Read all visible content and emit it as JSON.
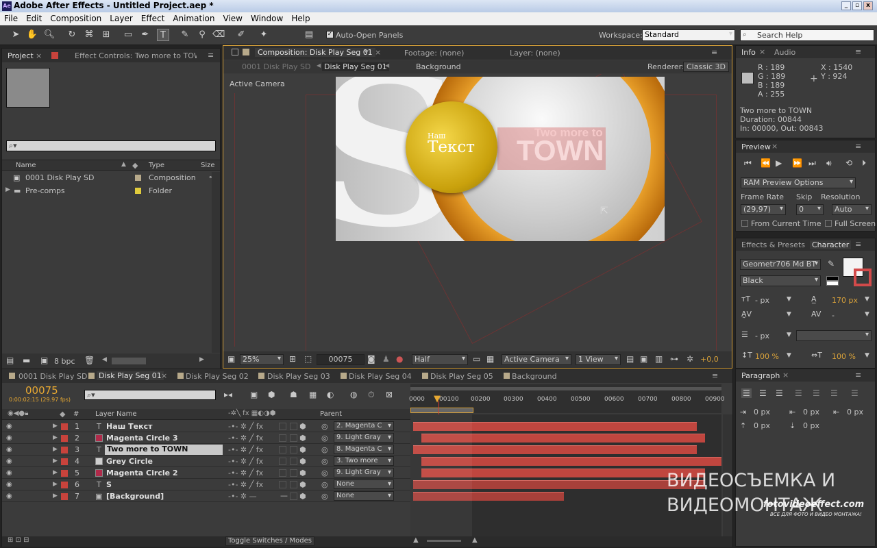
{
  "window": {
    "title": "Adobe After Effects - Untitled Project.aep *",
    "app_icon": "Ae"
  },
  "menu": [
    "File",
    "Edit",
    "Composition",
    "Layer",
    "Effect",
    "Animation",
    "View",
    "Window",
    "Help"
  ],
  "toolbar": {
    "auto_open_label": "Auto-Open Panels",
    "workspace_label": "Workspace:",
    "workspace_value": "Standard",
    "search_placeholder": "Search Help"
  },
  "project_panel": {
    "tab_project": "Project",
    "tab_effect_controls": "Effect Controls: Two more to TOWN",
    "columns": {
      "name": "Name",
      "type": "Type",
      "size": "Size"
    },
    "items": [
      {
        "name": "0001 Disk Play SD",
        "type": "Composition"
      },
      {
        "name": "Pre-comps",
        "type": "Folder"
      }
    ],
    "bpc": "8 bpc"
  },
  "comp_panel": {
    "tab_comp": "Composition: Disk Play Seg 01",
    "tab_footage": "Footage: (none)",
    "tab_layer": "Layer: (none)",
    "breadcrumbs": [
      "0001 Disk Play SD",
      "Disk Play Seg 01",
      "Background"
    ],
    "renderer_label": "Renderer:",
    "renderer_value": "Classic 3D",
    "active_camera": "Active Camera",
    "art_small": "Наш",
    "art_big": "Текст",
    "art_two": "Two more to",
    "art_town": "TOWN",
    "zoom": "25%",
    "timecode": "00075",
    "resolution": "Half",
    "camera": "Active Camera",
    "view": "1 View",
    "offset": "+0,0"
  },
  "info_panel": {
    "tab_info": "Info",
    "tab_audio": "Audio",
    "r": "R : 189",
    "g": "G : 189",
    "b": "B : 189",
    "a": "A : 255",
    "x": "X : 1540",
    "y": "Y : 924",
    "layer_name": "Two more to TOWN",
    "duration": "Duration: 00844",
    "in_out": "In: 00000, Out: 00843"
  },
  "preview_panel": {
    "tab": "Preview",
    "ram_options": "RAM Preview Options",
    "frame_rate_label": "Frame Rate",
    "skip_label": "Skip",
    "resolution_label": "Resolution",
    "frame_rate": "(29,97)",
    "skip": "0",
    "resolution": "Auto",
    "from_current": "From Current Time",
    "full_screen": "Full Screen"
  },
  "character_panel": {
    "tab_effects": "Effects & Presets",
    "tab_character": "Character",
    "font": "Geometr706 Md BT",
    "style": "Black",
    "size": "- px",
    "leading": "170 px",
    "tracking": "-",
    "stroke": "- px",
    "vscale": "100 %",
    "hscale": "100 %"
  },
  "paragraph_panel": {
    "tab": "Paragraph",
    "indent_left": "0 px",
    "indent_first": "0 px",
    "indent_right": "0 px",
    "space_before": "0 px",
    "space_after": "0 px"
  },
  "timeline": {
    "tabs": [
      "0001 Disk Play SD",
      "Disk Play Seg 01",
      "Disk Play Seg 02",
      "Disk Play Seg 03",
      "Disk Play Seg 04",
      "Disk Play Seg 05",
      "Background"
    ],
    "current_time": "00075",
    "fps": "0:00:02:15 (29.97 fps)",
    "col_num": "#",
    "col_layer": "Layer Name",
    "col_parent": "Parent",
    "ruler": [
      "0000",
      "00100",
      "00200",
      "00300",
      "00400",
      "00500",
      "00600",
      "00700",
      "00800",
      "00900"
    ],
    "layers": [
      {
        "num": "1",
        "name": "Наш Текст",
        "type": "T",
        "color": "#c8433c",
        "parent": "2. Magenta C"
      },
      {
        "num": "2",
        "name": "Magenta Circle 3",
        "type": "■",
        "color": "#c8433c",
        "parent": "9. Light Gray"
      },
      {
        "num": "3",
        "name": "Two more to TOWN",
        "type": "T",
        "color": "#c8433c",
        "parent": "8. Magenta C"
      },
      {
        "num": "4",
        "name": "Grey Circle",
        "type": "■",
        "color": "#c8433c",
        "parent": "3. Two more"
      },
      {
        "num": "5",
        "name": "Magenta Circle 2",
        "type": "■",
        "color": "#c8433c",
        "parent": "9. Light Gray"
      },
      {
        "num": "6",
        "name": "S",
        "type": "T",
        "color": "#c8433c",
        "parent": "None"
      },
      {
        "num": "7",
        "name": "[Background]",
        "type": "▣",
        "color": "#c8433c",
        "parent": "None"
      }
    ],
    "toggle_label": "Toggle Switches / Modes"
  },
  "watermark": {
    "line1": "ВИДЕОСЪЕМКА И",
    "line2": "ВИДЕОМОНТАЖ",
    "site": "fotovideoeffect.com",
    "tagline": "ВСЕ ДЛЯ ФОТО И ВИДЕО МОНТАЖА!"
  }
}
